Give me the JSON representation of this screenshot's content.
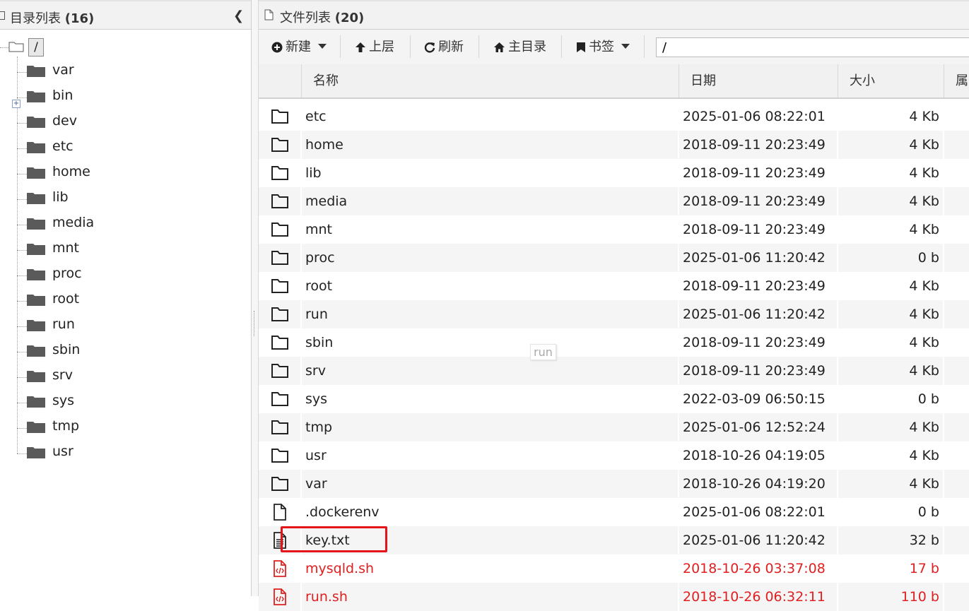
{
  "left_panel": {
    "title": "目录列表",
    "count": "(16)",
    "collapse_icon": "chevron-left-icon",
    "root": "/",
    "items": [
      {
        "label": "var"
      },
      {
        "label": "bin"
      },
      {
        "label": "dev"
      },
      {
        "label": "etc"
      },
      {
        "label": "home"
      },
      {
        "label": "lib"
      },
      {
        "label": "media"
      },
      {
        "label": "mnt"
      },
      {
        "label": "proc"
      },
      {
        "label": "root"
      },
      {
        "label": "run"
      },
      {
        "label": "sbin"
      },
      {
        "label": "srv"
      },
      {
        "label": "sys"
      },
      {
        "label": "tmp"
      },
      {
        "label": "usr"
      }
    ]
  },
  "right_panel": {
    "title": "文件列表",
    "count": "(20)",
    "toolbar": {
      "new_label": "新建",
      "up_label": "上层",
      "refresh_label": "刷新",
      "home_label": "主目录",
      "bookmark_label": "书签",
      "path_value": "/"
    },
    "columns": {
      "name": "名称",
      "date": "日期",
      "size": "大小",
      "attr": "属"
    },
    "rows": [
      {
        "name": "etc",
        "date": "2025-01-06 08:22:01",
        "size": "4 Kb",
        "type": "folder"
      },
      {
        "name": "home",
        "date": "2018-09-11 20:23:49",
        "size": "4 Kb",
        "type": "folder"
      },
      {
        "name": "lib",
        "date": "2018-09-11 20:23:49",
        "size": "4 Kb",
        "type": "folder"
      },
      {
        "name": "media",
        "date": "2018-09-11 20:23:49",
        "size": "4 Kb",
        "type": "folder"
      },
      {
        "name": "mnt",
        "date": "2018-09-11 20:23:49",
        "size": "4 Kb",
        "type": "folder"
      },
      {
        "name": "proc",
        "date": "2025-01-06 11:20:42",
        "size": "0 b",
        "type": "folder"
      },
      {
        "name": "root",
        "date": "2018-09-11 20:23:49",
        "size": "4 Kb",
        "type": "folder"
      },
      {
        "name": "run",
        "date": "2025-01-06 11:20:42",
        "size": "4 Kb",
        "type": "folder"
      },
      {
        "name": "sbin",
        "date": "2018-09-11 20:23:49",
        "size": "4 Kb",
        "type": "folder"
      },
      {
        "name": "srv",
        "date": "2018-09-11 20:23:49",
        "size": "4 Kb",
        "type": "folder"
      },
      {
        "name": "sys",
        "date": "2022-03-09 06:50:15",
        "size": "0 b",
        "type": "folder"
      },
      {
        "name": "tmp",
        "date": "2025-01-06 12:52:24",
        "size": "4 Kb",
        "type": "folder"
      },
      {
        "name": "usr",
        "date": "2018-10-26 04:19:05",
        "size": "4 Kb",
        "type": "folder"
      },
      {
        "name": "var",
        "date": "2018-10-26 04:19:20",
        "size": "4 Kb",
        "type": "folder"
      },
      {
        "name": ".dockerenv",
        "date": "2025-01-06 08:22:01",
        "size": "0 b",
        "type": "file"
      },
      {
        "name": "key.txt",
        "date": "2025-01-06 11:20:42",
        "size": "32 b",
        "type": "text"
      },
      {
        "name": "mysqld.sh",
        "date": "2018-10-26 03:37:08",
        "size": "17 b",
        "type": "script"
      },
      {
        "name": "run.sh",
        "date": "2018-10-26 06:32:11",
        "size": "110 b",
        "type": "script"
      }
    ]
  },
  "drag_tooltip": "run",
  "colors": {
    "script_text": "#e02020",
    "highlight": "#e4141a",
    "folder_icon": "#5a5a5a"
  }
}
